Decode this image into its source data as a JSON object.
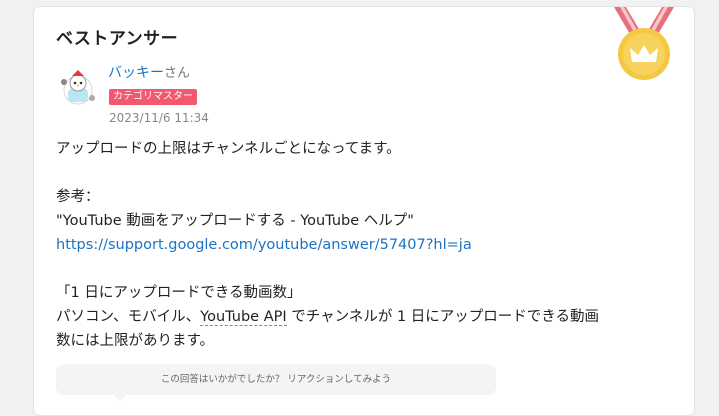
{
  "heading": "ベストアンサー",
  "user": {
    "name": "バッキー",
    "suffix": "さん",
    "badge": "カテゴリマスター",
    "date": "2023/11/6 11:34"
  },
  "answer": {
    "line1": "アップロードの上限はチャンネルごとになってます。",
    "ref_label": "参考：",
    "ref_title": "\"YouTube 動画をアップロードする - YouTube ヘルプ\"",
    "ref_url": "https://support.google.com/youtube/answer/57407?hl=ja",
    "quote_title": "「1 日にアップロードできる動画数」",
    "quote_body_1_pre": "パソコン、モバイル、",
    "quote_body_1_link": "YouTube API",
    "quote_body_1_post": " でチャンネルが 1 日にアップロードできる動画",
    "quote_body_2": "数には上限があります。"
  },
  "reaction_prompt": "この回答はいかがでしたか？ リアクションしてみよう",
  "colors": {
    "link": "#1a73c7",
    "badge": "#f4586f",
    "medal": "#f5c842",
    "ribbon": "#e8707e"
  },
  "icons": {
    "medal": "crown-medal-icon",
    "avatar": "user-avatar"
  }
}
